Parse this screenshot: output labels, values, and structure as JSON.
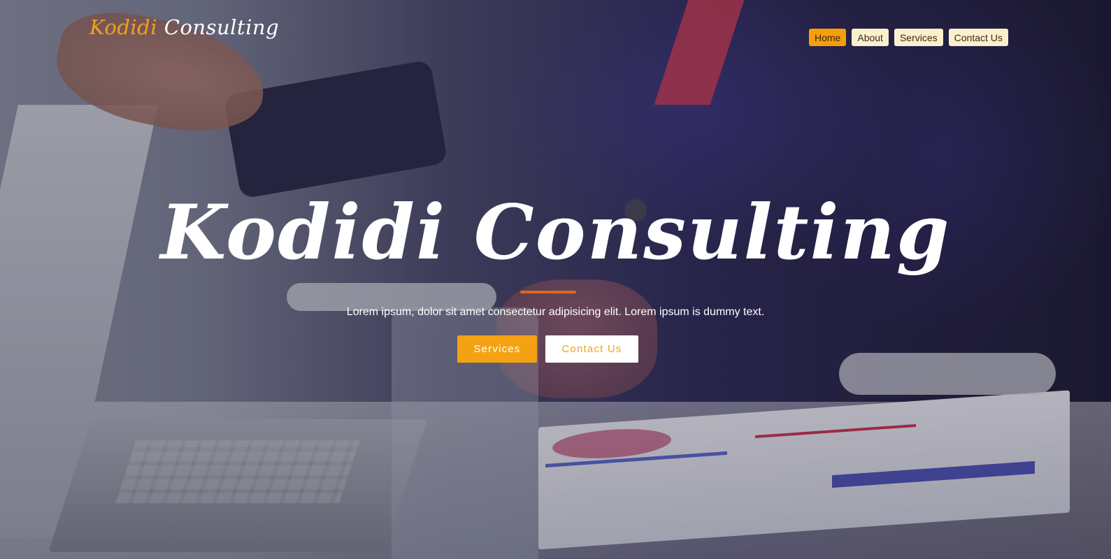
{
  "header": {
    "logo_part1": "Kodidi",
    "logo_part2": "Consulting"
  },
  "nav": {
    "items": [
      {
        "label": "Home",
        "active": true
      },
      {
        "label": "About",
        "active": false
      },
      {
        "label": "Services",
        "active": false
      },
      {
        "label": "Contact Us",
        "active": false
      }
    ]
  },
  "hero": {
    "title": "Kodidi Consulting",
    "subtitle": "Lorem ipsum, dolor sit amet consectetur adipisicing elit. Lorem ipsum is dummy text.",
    "primary_button": "Services",
    "secondary_button": "Contact Us"
  },
  "colors": {
    "accent": "#f4a214",
    "nav_bg": "#fbf0cc",
    "divider": "#d9691f"
  }
}
